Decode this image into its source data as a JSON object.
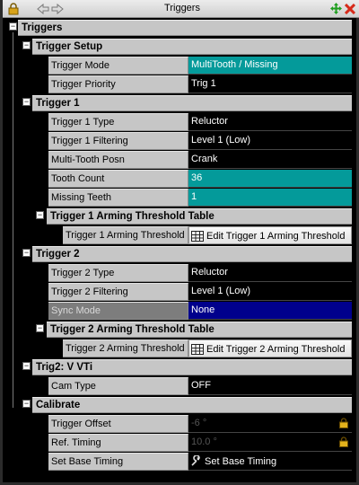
{
  "window": {
    "title": "Triggers"
  },
  "tree": {
    "root": {
      "label": "Triggers"
    },
    "trigger_setup": {
      "label": "Trigger Setup",
      "rows": [
        {
          "name": "Trigger Mode",
          "value": "MultiTooth / Missing"
        },
        {
          "name": "Trigger Priority",
          "value": "Trig 1"
        }
      ]
    },
    "trigger1": {
      "label": "Trigger 1",
      "rows": [
        {
          "name": "Trigger 1 Type",
          "value": "Reluctor"
        },
        {
          "name": "Trigger 1 Filtering",
          "value": "Level 1 (Low)"
        },
        {
          "name": "Multi-Tooth Posn",
          "value": "Crank"
        },
        {
          "name": "Tooth Count",
          "value": "36"
        },
        {
          "name": "Missing Teeth",
          "value": "1"
        }
      ],
      "arming": {
        "label": "Trigger 1 Arming Threshold Table",
        "name": "Trigger 1 Arming Threshold",
        "button": "Edit Trigger 1 Arming Threshold"
      }
    },
    "trigger2": {
      "label": "Trigger 2",
      "rows": [
        {
          "name": "Trigger 2 Type",
          "value": "Reluctor"
        },
        {
          "name": "Trigger 2 Filtering",
          "value": "Level 1 (Low)"
        },
        {
          "name": "Sync Mode",
          "value": "None"
        }
      ],
      "arming": {
        "label": "Trigger 2 Arming Threshold Table",
        "name": "Trigger 2 Arming Threshold",
        "button": "Edit Trigger 2 Arming Threshold"
      }
    },
    "trig2_vvti": {
      "label": "Trig2: V VTi",
      "rows": [
        {
          "name": "Cam Type",
          "value": "OFF"
        }
      ]
    },
    "calibrate": {
      "label": "Calibrate",
      "rows": [
        {
          "name": "Trigger Offset",
          "value": "-6 °"
        },
        {
          "name": "Ref. Timing",
          "value": "10.0 °"
        },
        {
          "name": "Set Base Timing",
          "value": "Set Base Timing"
        }
      ]
    }
  },
  "colors": {
    "teal": "#049a9a",
    "navy": "#00008c",
    "category_bg": "#c6c6c6",
    "value_bg": "#000000"
  },
  "icons": [
    "lock-icon",
    "back-arrow-icon",
    "forward-arrow-icon",
    "move-icon",
    "close-icon",
    "table-grid-icon",
    "wrench-icon",
    "padlock-icon"
  ]
}
